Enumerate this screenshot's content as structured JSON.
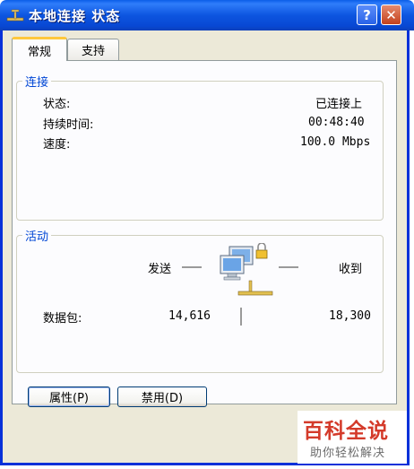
{
  "window": {
    "title": "本地连接 状态",
    "help_label": "?",
    "close_label": "✕"
  },
  "tabs": [
    {
      "label": "常规"
    },
    {
      "label": "支持"
    }
  ],
  "connection": {
    "title": "连接",
    "status_label": "状态:",
    "status_value": "已连接上",
    "duration_label": "持续时间:",
    "duration_value": "00:48:40",
    "speed_label": "速度:",
    "speed_value": "100.0 Mbps"
  },
  "activity": {
    "title": "活动",
    "sent_label": "发送",
    "received_label": "收到",
    "packets_label": "数据包:",
    "packets_sent": "14,616",
    "packets_received": "18,300"
  },
  "buttons": {
    "properties_label": "属性(P)",
    "disable_label": "禁用(D)"
  },
  "watermark": {
    "main": "百科全说",
    "sub": "助你轻松解决"
  },
  "icons": [
    "network-connection-icon",
    "help-icon",
    "close-icon",
    "network-activity-icon"
  ],
  "colors": {
    "titlebar": "#0a5ee8",
    "group_title": "#0046d5",
    "watermark": "#d43a2a"
  }
}
